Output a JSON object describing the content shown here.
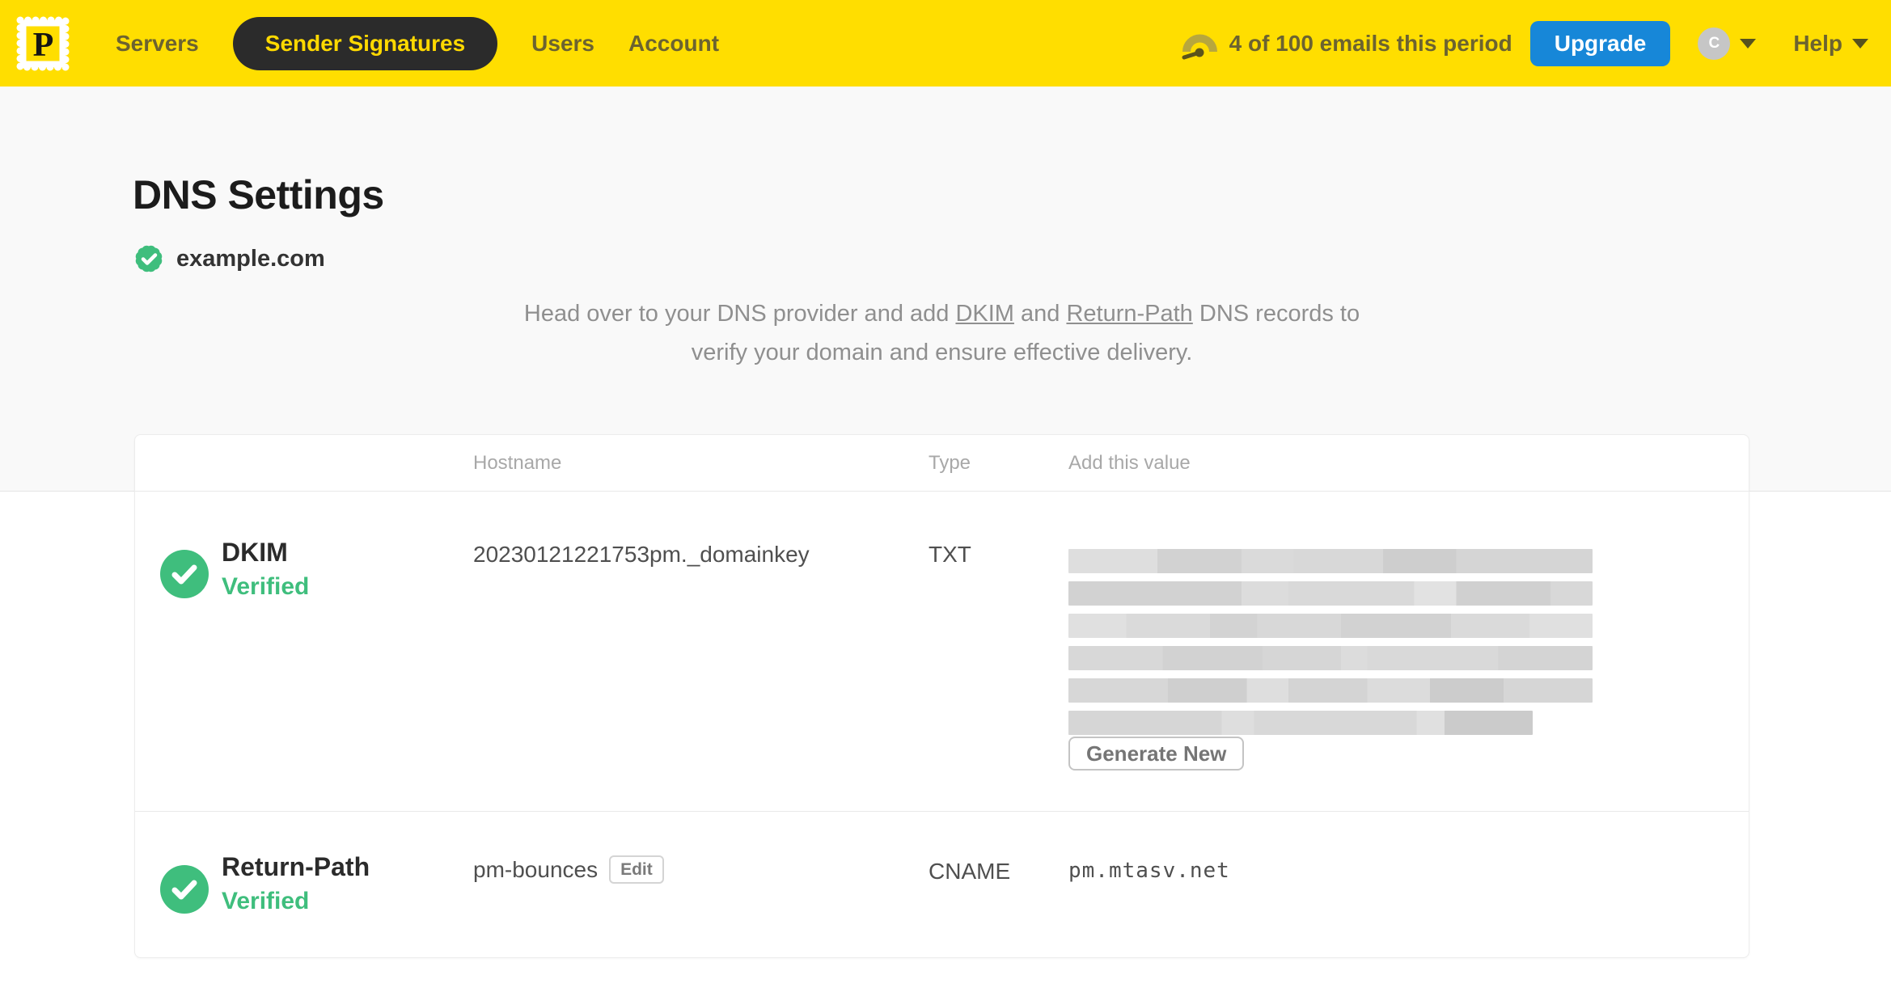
{
  "nav": {
    "logo_letter": "P",
    "items": [
      {
        "label": "Servers",
        "active": false
      },
      {
        "label": "Sender Signatures",
        "active": true
      },
      {
        "label": "Users",
        "active": false
      },
      {
        "label": "Account",
        "active": false
      }
    ],
    "usage_text": "4 of 100 emails this period",
    "upgrade_label": "Upgrade",
    "avatar_initial": "C",
    "help_label": "Help"
  },
  "page": {
    "title": "DNS Settings",
    "domain": "example.com",
    "domain_verified": true,
    "description": {
      "part1": "Head over to your DNS provider and add ",
      "link_dkim": "DKIM",
      "part2": " and ",
      "link_return_path": "Return-Path",
      "part3": " DNS records to",
      "part4": "verify your domain and ensure effective delivery."
    }
  },
  "table": {
    "headers": {
      "hostname": "Hostname",
      "type": "Type",
      "value": "Add this value"
    },
    "rows": [
      {
        "name": "DKIM",
        "status": "Verified",
        "hostname": "20230121221753pm._domainkey",
        "type": "TXT",
        "value_redacted": true,
        "value_lines": 6,
        "action_label": "Generate New"
      },
      {
        "name": "Return-Path",
        "status": "Verified",
        "hostname": "pm-bounces",
        "edit_label": "Edit",
        "type": "CNAME",
        "value": "pm.mtasv.net"
      }
    ]
  },
  "colors": {
    "navbar_yellow": "#FFDE00",
    "nav_text_olive": "#6c6330",
    "active_pill_bg": "#2b2b2b",
    "active_pill_text": "#ffd900",
    "upgrade_blue": "#1787d8",
    "verified_green": "#3fbe7d",
    "page_bg_gray": "#f9f9f9"
  }
}
